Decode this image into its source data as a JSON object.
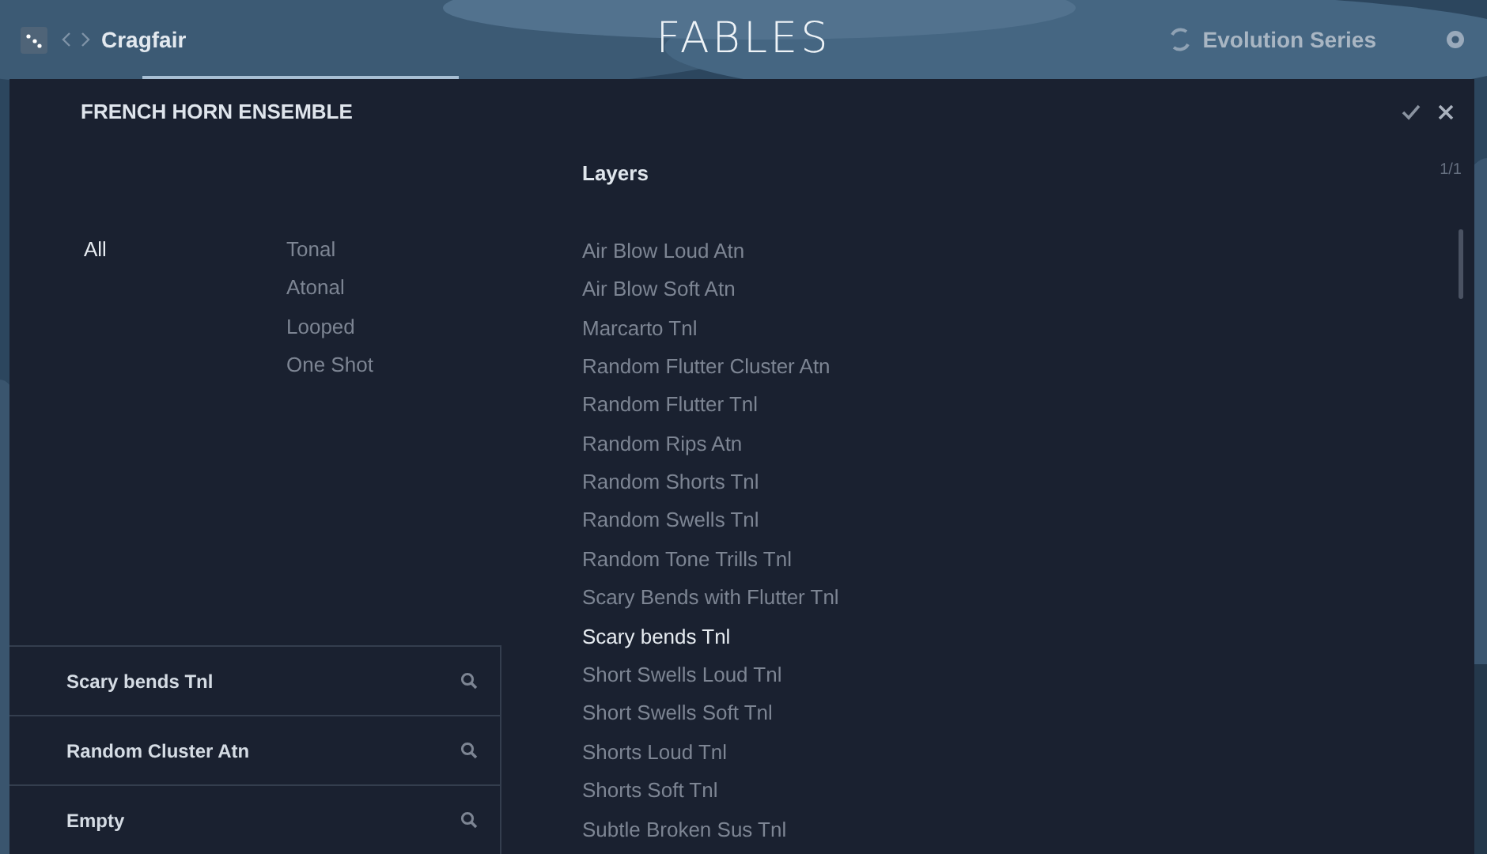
{
  "top_bar": {
    "breadcrumb": "Cragfair",
    "logo": "FABLES",
    "series": "Evolution Series"
  },
  "panel": {
    "title": "FRENCH HORN ENSEMBLE",
    "layers_heading": "Layers",
    "page": "1/1"
  },
  "groups": [
    {
      "label": "All",
      "selected": true
    }
  ],
  "types": [
    {
      "label": "Tonal",
      "selected": false
    },
    {
      "label": "Atonal",
      "selected": false
    },
    {
      "label": "Looped",
      "selected": false
    },
    {
      "label": "One Shot",
      "selected": false
    }
  ],
  "layers": [
    {
      "label": "Air Blow Loud Atn",
      "selected": false
    },
    {
      "label": "Air Blow Soft Atn",
      "selected": false
    },
    {
      "label": "Marcarto Tnl",
      "selected": false
    },
    {
      "label": "Random Flutter Cluster Atn",
      "selected": false
    },
    {
      "label": "Random Flutter Tnl",
      "selected": false
    },
    {
      "label": "Random Rips Atn",
      "selected": false
    },
    {
      "label": "Random Shorts Tnl",
      "selected": false
    },
    {
      "label": "Random Swells Tnl",
      "selected": false
    },
    {
      "label": "Random Tone Trills Tnl",
      "selected": false
    },
    {
      "label": "Scary Bends with Flutter Tnl",
      "selected": false
    },
    {
      "label": "Scary bends Tnl",
      "selected": true
    },
    {
      "label": "Short Swells Loud Tnl",
      "selected": false
    },
    {
      "label": "Short Swells Soft Tnl",
      "selected": false
    },
    {
      "label": "Shorts Loud Tnl",
      "selected": false
    },
    {
      "label": "Shorts Soft Tnl",
      "selected": false
    },
    {
      "label": "Subtle Broken Sus Tnl",
      "selected": false
    }
  ],
  "slots": [
    {
      "label": "Scary bends Tnl"
    },
    {
      "label": "Random Cluster Atn"
    },
    {
      "label": "Empty"
    }
  ]
}
